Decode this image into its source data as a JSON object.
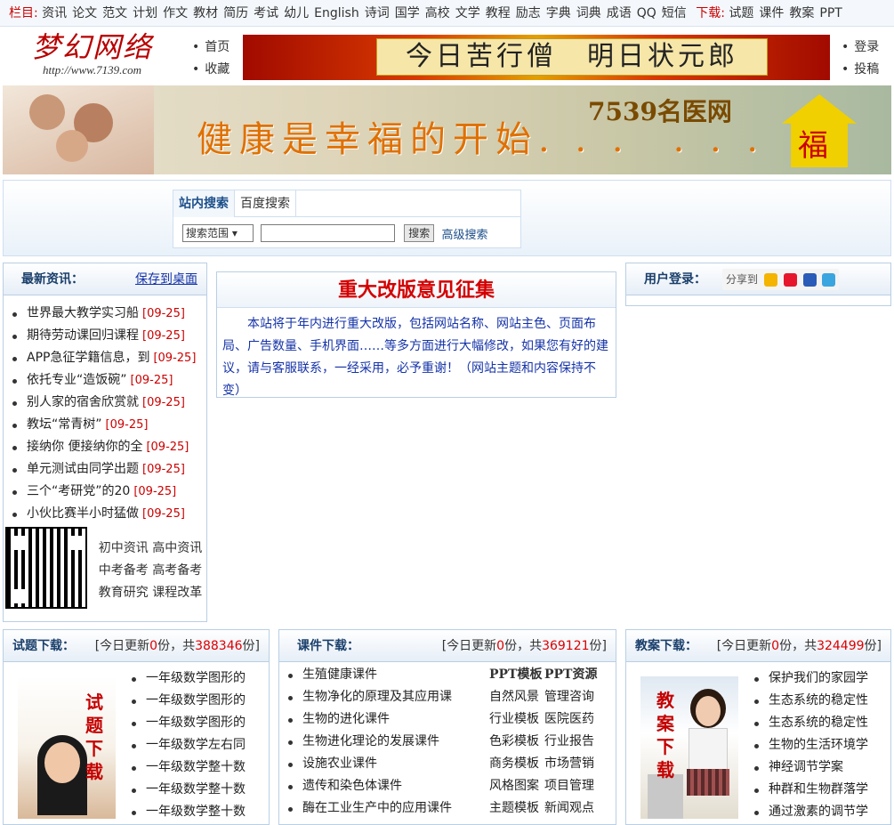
{
  "topnav": {
    "label_column": "栏目:",
    "columns": [
      "资讯",
      "论文",
      "范文",
      "计划",
      "作文",
      "教材",
      "简历",
      "考试",
      "幼儿",
      "English",
      "诗词",
      "国学",
      "高校",
      "文学",
      "教程",
      "励志",
      "字典",
      "词典",
      "成语",
      "QQ",
      "短信"
    ],
    "label_download": "下载:",
    "downloads": [
      "试题",
      "课件",
      "教案",
      "PPT"
    ]
  },
  "header": {
    "logo_text": "梦幻网络",
    "logo_url": "http://www.7139.com",
    "left_links": [
      "首页",
      "收藏"
    ],
    "right_links": [
      "登录",
      "投稿"
    ],
    "banner_text": "今日苦行僧　明日状元郎"
  },
  "banner2": {
    "slogan": "健康是幸福的开始. . .　. . .",
    "brand": "7539名医网",
    "fu": "福"
  },
  "search": {
    "tab_site": "站内搜索",
    "tab_baidu": "百度搜索",
    "scope": "搜索范围",
    "button": "搜索",
    "advanced": "高级搜索"
  },
  "news": {
    "title": "最新资讯：",
    "save": "保存到桌面",
    "items": [
      {
        "t": "世界最大教学实习船",
        "d": "[09-25]"
      },
      {
        "t": "期待劳动课回归课程",
        "d": "[09-25]"
      },
      {
        "t": "APP急征学籍信息，到",
        "d": "[09-25]"
      },
      {
        "t": "依托专业“造饭碗”",
        "d": "[09-25]"
      },
      {
        "t": "别人家的宿舍欣赏就",
        "d": "[09-25]"
      },
      {
        "t": "教坛“常青树”",
        "d": "[09-25]"
      },
      {
        "t": "接纳你 便接纳你的全",
        "d": "[09-25]"
      },
      {
        "t": "单元测试由同学出题",
        "d": "[09-25]"
      },
      {
        "t": "三个“考研党”的20",
        "d": "[09-25]"
      },
      {
        "t": "小伙比赛半小时猛做",
        "d": "[09-25]"
      }
    ],
    "qr_links": "初中资讯 高中资讯 中考备考 高考备考 教育研究 课程改革"
  },
  "notice": {
    "title": "重大改版意见征集",
    "body": "本站将于年内进行重大改版，包括网站名称、网站主色、页面布局、广告数量、手机界面……等多方面进行大幅修改，如果您有好的建议，请与客服联系，一经采用，必予重谢！（网站主题和内容保持不变）"
  },
  "login": {
    "title": "用户登录：",
    "share": "分享到"
  },
  "exams": {
    "title": "试题下载：",
    "stat_pre": "[今日更新",
    "stat_today": "0",
    "stat_mid": "份，共",
    "stat_total": "388346",
    "stat_post": "份]",
    "thumb_text": "试题下载",
    "items": [
      "一年级数学图形的",
      "一年级数学图形的",
      "一年级数学图形的",
      "一年级数学左右同",
      "一年级数学整十数",
      "一年级数学整十数",
      "一年级数学整十数"
    ]
  },
  "courseware": {
    "title": "课件下载：",
    "stat_pre": "[今日更新",
    "stat_today": "0",
    "stat_mid": "份，共",
    "stat_total": "369121",
    "stat_post": "份]",
    "items": [
      "生殖健康课件",
      "生物净化的原理及其应用课",
      "生物的进化课件",
      "生物进化理论的发展课件",
      "设施农业课件",
      "遗传和染色体课件",
      "酶在工业生产中的应用课件"
    ],
    "ppt_head": [
      "PPT模板",
      "PPT资源"
    ],
    "ppt_rows": [
      [
        "自然风景",
        "管理咨询"
      ],
      [
        "行业模板",
        "医院医药"
      ],
      [
        "色彩模板",
        "行业报告"
      ],
      [
        "商务模板",
        "市场营销"
      ],
      [
        "风格图案",
        "项目管理"
      ],
      [
        "主题模板",
        "新闻观点"
      ]
    ]
  },
  "lessons": {
    "title": "教案下载：",
    "stat_pre": "[今日更新",
    "stat_today": "0",
    "stat_mid": "份，共",
    "stat_total": "324499",
    "stat_post": "份]",
    "thumb_text": "教案下载",
    "items": [
      "保护我们的家园学",
      "生态系统的稳定性",
      "生态系统的稳定性",
      "生物的生活环境学",
      "神经调节学案",
      "种群和生物群落学",
      "通过激素的调节学"
    ]
  }
}
